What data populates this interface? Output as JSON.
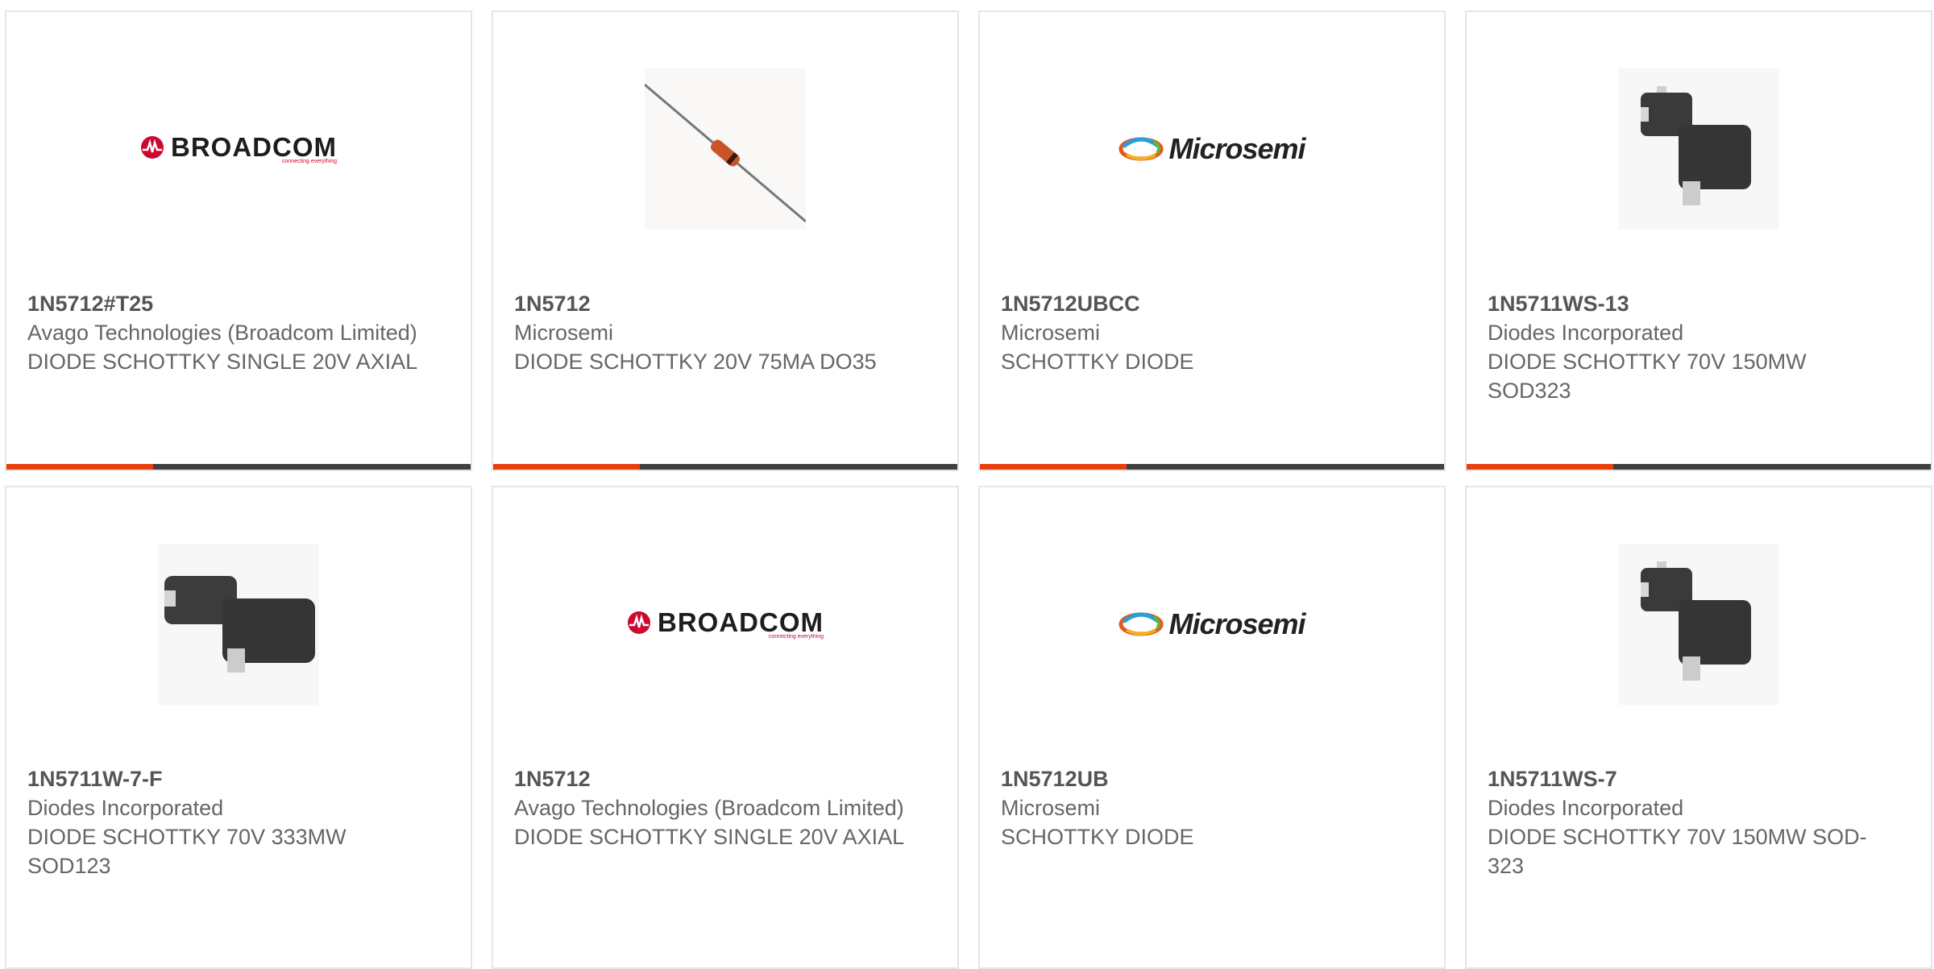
{
  "products": [
    {
      "part": "1N5712#T25",
      "manufacturer": "Avago Technologies (Broadcom Limited)",
      "description": "DIODE SCHOTTKY SINGLE 20V AXIAL",
      "image": "broadcom-logo",
      "image_text": "BROADCOM",
      "image_tagline": "connecting everything"
    },
    {
      "part": "1N5712",
      "manufacturer": "Microsemi",
      "description": "DIODE SCHOTTKY 20V 75MA DO35",
      "image": "axial-diode-photo"
    },
    {
      "part": "1N5712UBCC",
      "manufacturer": "Microsemi",
      "description": "SCHOTTKY DIODE",
      "image": "microsemi-logo",
      "image_text": "Microsemi"
    },
    {
      "part": "1N5711WS-13",
      "manufacturer": "Diodes Incorporated",
      "description": "DIODE SCHOTTKY 70V 150MW SOD323",
      "image": "sod323-package-photo"
    },
    {
      "part": "1N5711W-7-F",
      "manufacturer": "Diodes Incorporated",
      "description": "DIODE SCHOTTKY 70V 333MW SOD123",
      "image": "sod123-package-photo"
    },
    {
      "part": "1N5712",
      "manufacturer": "Avago Technologies (Broadcom Limited)",
      "description": "DIODE SCHOTTKY SINGLE 20V AXIAL",
      "image": "broadcom-logo",
      "image_text": "BROADCOM",
      "image_tagline": "connecting everything"
    },
    {
      "part": "1N5712UB",
      "manufacturer": "Microsemi",
      "description": "SCHOTTKY DIODE",
      "image": "microsemi-logo",
      "image_text": "Microsemi"
    },
    {
      "part": "1N5711WS-7",
      "manufacturer": "Diodes Incorporated",
      "description": "DIODE SCHOTTKY 70V 150MW SOD-323",
      "image": "sod323-package-photo"
    }
  ],
  "colors": {
    "accent": "#e8400d",
    "bar": "#404040",
    "border": "#e6e6e6",
    "text": "#666666",
    "part": "#555555"
  }
}
